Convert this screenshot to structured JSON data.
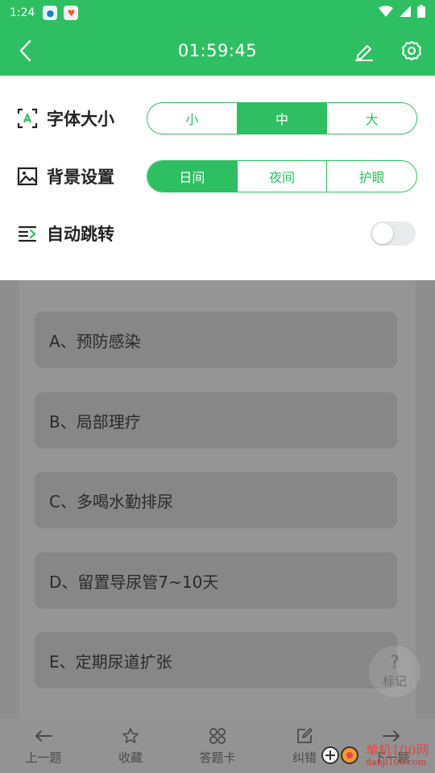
{
  "status_bar": {
    "time": "1:24"
  },
  "header": {
    "timer": "01:59:45"
  },
  "settings": {
    "font_size": {
      "label": "字体大小",
      "options": [
        "小",
        "中",
        "大"
      ],
      "selected": "中"
    },
    "background": {
      "label": "背景设置",
      "options": [
        "日间",
        "夜间",
        "护眼"
      ],
      "selected": "日间"
    },
    "auto_jump": {
      "label": "自动跳转",
      "enabled": false
    }
  },
  "question": {
    "options": [
      "A、预防感染",
      "B、局部理疗",
      "C、多喝水勤排尿",
      "D、留置导尿管7~10天",
      "E、定期尿道扩张"
    ]
  },
  "mark_button": {
    "icon": "?",
    "label": "标记"
  },
  "bottom_nav": {
    "prev": "上一题",
    "favorite": "收藏",
    "answer_card": "答题卡",
    "correct": "纠错",
    "next": "下一题"
  },
  "watermark": {
    "line1": "单机100网",
    "line2": "danji100.com"
  },
  "colors": {
    "accent": "#2fbf63"
  }
}
